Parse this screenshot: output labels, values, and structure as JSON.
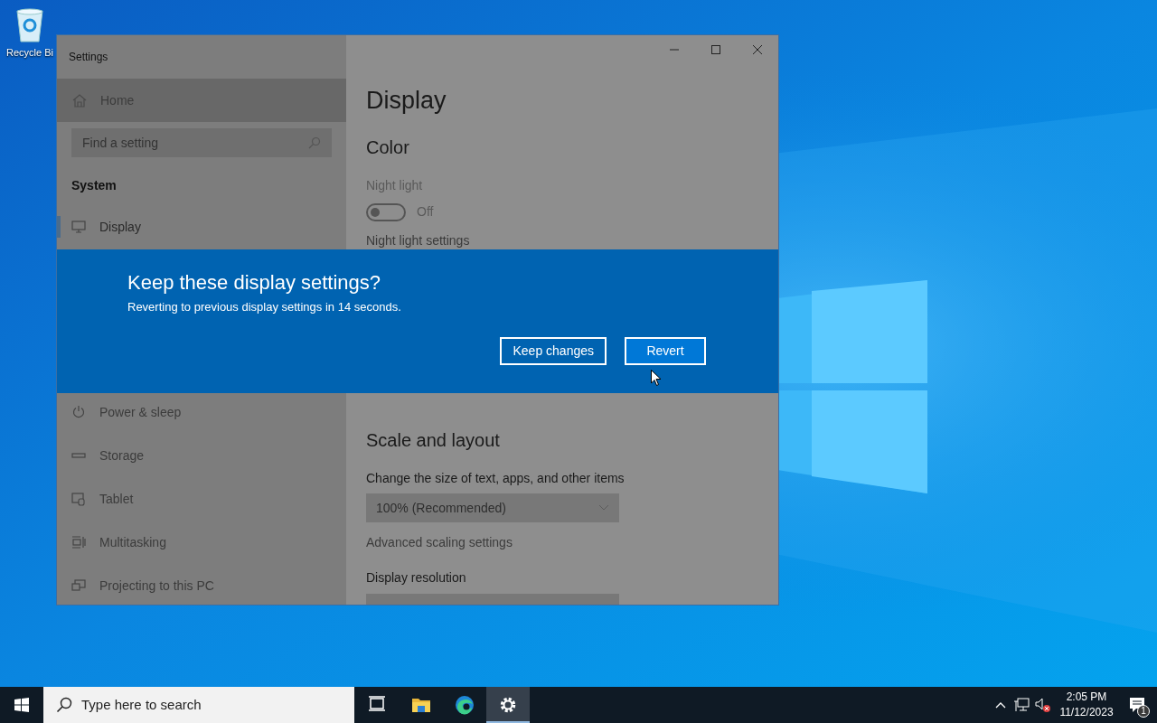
{
  "desktop_icons": [
    {
      "label": "Recycle Bi"
    }
  ],
  "window": {
    "title": "Settings"
  },
  "sidebar": {
    "home": "Home",
    "search_placeholder": "Find a setting",
    "section": "System",
    "items": [
      {
        "label": "Display",
        "kind": "monitor",
        "selected": true
      },
      {
        "label": "Power & sleep",
        "kind": "power",
        "selected": false
      },
      {
        "label": "Storage",
        "kind": "storage",
        "selected": false
      },
      {
        "label": "Tablet",
        "kind": "tablet",
        "selected": false
      },
      {
        "label": "Multitasking",
        "kind": "multitask",
        "selected": false
      },
      {
        "label": "Projecting to this PC",
        "kind": "project",
        "selected": false
      }
    ]
  },
  "content": {
    "title": "Display",
    "color_heading": "Color",
    "night_light": {
      "label": "Night light",
      "on": false,
      "state_text": "Off"
    },
    "night_light_link": "Night light settings",
    "scale_heading": "Scale and layout",
    "scale_label": "Change the size of text, apps, and other items",
    "scale_value": "100% (Recommended)",
    "scale_link": "Advanced scaling settings",
    "resolution_label": "Display resolution"
  },
  "dialog": {
    "title": "Keep these display settings?",
    "message": "Reverting to previous display settings in 14 seconds.",
    "buttons": [
      {
        "label": "Keep changes",
        "primary": false
      },
      {
        "label": "Revert",
        "primary": true
      }
    ]
  },
  "taskbar": {
    "search_placeholder": "Type here to search",
    "apps": [
      {
        "kind": "taskview",
        "active": false
      },
      {
        "kind": "explorer",
        "active": false
      },
      {
        "kind": "edge",
        "active": false
      },
      {
        "kind": "settings",
        "active": true
      }
    ],
    "time": "2:05 PM",
    "date": "11/12/2023",
    "notification_count": "1"
  }
}
